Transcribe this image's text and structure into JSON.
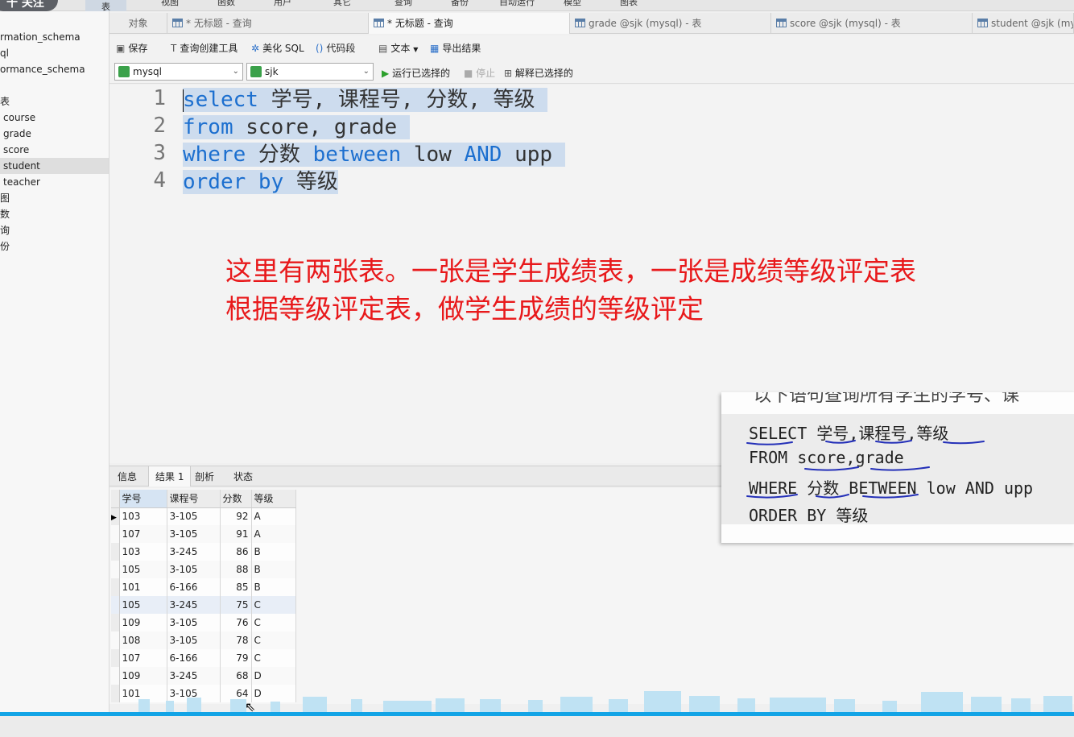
{
  "follow_button": "十 关注",
  "menu": [
    "表",
    "视图",
    "函数",
    "用户",
    "其它",
    "查询",
    "备份",
    "自动运行",
    "模型",
    "图表"
  ],
  "sidebar": {
    "items": [
      "rmation_schema",
      "ql",
      "ormance_schema",
      "表",
      "course",
      "grade",
      "score",
      "student",
      "teacher",
      "图",
      "数",
      "询",
      "份"
    ],
    "selected": "student"
  },
  "tabs": [
    "对象",
    "* 无标题 - 查询",
    "* 无标题 - 查询",
    "grade @sjk (mysql) - 表",
    "score @sjk (mysql) - 表",
    "student @sjk (mys"
  ],
  "toolbar": {
    "save": "保存",
    "query_builder": "查询创建工具",
    "beautify": "美化 SQL",
    "snippet": "代码段",
    "text": "文本",
    "export": "导出结果"
  },
  "toolbar2": {
    "connection": "mysql",
    "database": "sjk",
    "run_selected": "运行已选择的",
    "stop": "停止",
    "explain": "解释已选择的"
  },
  "editor": {
    "line_numbers": [
      "1",
      "2",
      "3",
      "4"
    ],
    "lines": [
      [
        {
          "t": "select",
          "k": true
        },
        {
          "t": " 学号, 课程号, 分数, 等级 ",
          "k": false
        }
      ],
      [
        {
          "t": "from",
          "k": true
        },
        {
          "t": " score, grade ",
          "k": false
        }
      ],
      [
        {
          "t": "where",
          "k": true
        },
        {
          "t": " 分数 ",
          "k": false
        },
        {
          "t": "between",
          "k": true
        },
        {
          "t": " low ",
          "k": false
        },
        {
          "t": "AND",
          "k": true
        },
        {
          "t": " upp ",
          "k": false
        }
      ],
      [
        {
          "t": "order by",
          "k": true
        },
        {
          "t": " 等级",
          "k": false
        }
      ]
    ]
  },
  "annotation": {
    "line1": "这里有两张表。一张是学生成绩表，一张是成绩等级评定表",
    "line2": "根据等级评定表，做学生成绩的等级评定"
  },
  "result_tabs": [
    "信息",
    "结果 1",
    "剖析",
    "状态"
  ],
  "result_table": {
    "columns": [
      "学号",
      "课程号",
      "分数",
      "等级"
    ],
    "rows": [
      [
        "103",
        "3-105",
        "92",
        "A"
      ],
      [
        "107",
        "3-105",
        "91",
        "A"
      ],
      [
        "103",
        "3-245",
        "86",
        "B"
      ],
      [
        "105",
        "3-105",
        "88",
        "B"
      ],
      [
        "101",
        "6-166",
        "85",
        "B"
      ],
      [
        "105",
        "3-245",
        "75",
        "C"
      ],
      [
        "109",
        "3-105",
        "76",
        "C"
      ],
      [
        "108",
        "3-105",
        "78",
        "C"
      ],
      [
        "107",
        "6-166",
        "79",
        "C"
      ],
      [
        "109",
        "3-245",
        "68",
        "D"
      ],
      [
        "101",
        "3-105",
        "64",
        "D"
      ]
    ]
  },
  "snippet": {
    "cut_text": "以下语句查询所有学生的学号、课",
    "lines": [
      "SELECT 学号,课程号,等级",
      "FROM score,grade",
      "WHERE 分数 BETWEEN low AND upp",
      "ORDER BY 等级"
    ]
  },
  "colors": {
    "keyword": "#1c6fcf",
    "selection": "#cddcee",
    "annotation": "#e8191b",
    "accent_bar": "#12a4e6"
  }
}
